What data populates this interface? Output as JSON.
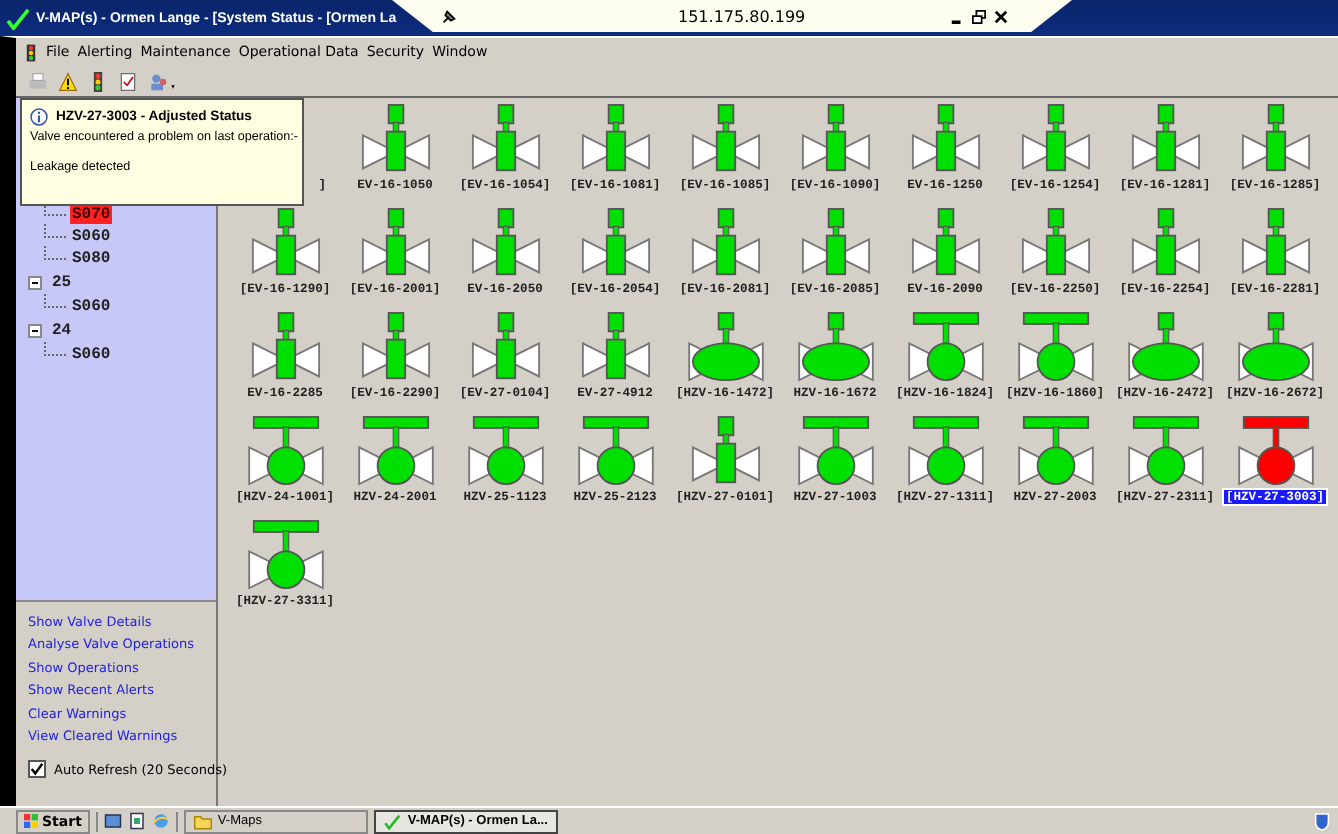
{
  "window": {
    "title": "V-MAP(s) - Ormen Lange - [System Status - [Ormen La"
  },
  "remote_bar": {
    "address": "151.175.80.199"
  },
  "menu": [
    "File",
    "Alerting",
    "Maintenance",
    "Operational Data",
    "Security",
    "Window"
  ],
  "tooltip": {
    "title": "HZV-27-3003 - Adjusted Status",
    "message": "Valve encountered a problem on last operation:-",
    "detail": "Leakage detected"
  },
  "tree": [
    {
      "children": [
        {
          "label": "S070",
          "alert": true
        },
        {
          "label": "S060",
          "alert": false
        },
        {
          "label": "S080",
          "alert": false
        }
      ]
    },
    {
      "label": "25",
      "expanded": true,
      "children": [
        {
          "label": "S060",
          "alert": false
        }
      ]
    },
    {
      "label": "24",
      "expanded": true,
      "children": [
        {
          "label": "S060",
          "alert": false
        }
      ]
    }
  ],
  "actions": [
    "Show Valve Details",
    "Analyse Valve Operations",
    "Show Operations",
    "Show Recent Alerts",
    "Clear Warnings",
    "View Cleared Warnings"
  ],
  "auto_refresh": {
    "label": "Auto Refresh (20 Seconds)",
    "checked": true
  },
  "valves": [
    {
      "label": "]",
      "kind": "hidden",
      "selected": false
    },
    {
      "label": "EV-16-1050",
      "kind": "gate",
      "color": "#00e000",
      "selected": false
    },
    {
      "label": "[EV-16-1054]",
      "kind": "gate",
      "color": "#00e000",
      "selected": false
    },
    {
      "label": "[EV-16-1081]",
      "kind": "gate",
      "color": "#00e000",
      "selected": false
    },
    {
      "label": "[EV-16-1085]",
      "kind": "gate",
      "color": "#00e000",
      "selected": false
    },
    {
      "label": "[EV-16-1090]",
      "kind": "gate",
      "color": "#00e000",
      "selected": false
    },
    {
      "label": "EV-16-1250",
      "kind": "gate",
      "color": "#00e000",
      "selected": false
    },
    {
      "label": "[EV-16-1254]",
      "kind": "gate",
      "color": "#00e000",
      "selected": false
    },
    {
      "label": "[EV-16-1281]",
      "kind": "gate",
      "color": "#00e000",
      "selected": false
    },
    {
      "label": "[EV-16-1285]",
      "kind": "gate",
      "color": "#00e000",
      "selected": false
    },
    {
      "label": "[EV-16-1290]",
      "kind": "gate",
      "color": "#00e000",
      "selected": false
    },
    {
      "label": "[EV-16-2001]",
      "kind": "gate",
      "color": "#00e000",
      "selected": false
    },
    {
      "label": "EV-16-2050",
      "kind": "gate",
      "color": "#00e000",
      "selected": false
    },
    {
      "label": "[EV-16-2054]",
      "kind": "gate",
      "color": "#00e000",
      "selected": false
    },
    {
      "label": "[EV-16-2081]",
      "kind": "gate",
      "color": "#00e000",
      "selected": false
    },
    {
      "label": "[EV-16-2085]",
      "kind": "gate",
      "color": "#00e000",
      "selected": false
    },
    {
      "label": "EV-16-2090",
      "kind": "gate",
      "color": "#00e000",
      "selected": false
    },
    {
      "label": "[EV-16-2250]",
      "kind": "gate",
      "color": "#00e000",
      "selected": false
    },
    {
      "label": "[EV-16-2254]",
      "kind": "gate",
      "color": "#00e000",
      "selected": false
    },
    {
      "label": "[EV-16-2281]",
      "kind": "gate",
      "color": "#00e000",
      "selected": false
    },
    {
      "label": "EV-16-2285",
      "kind": "gate",
      "color": "#00e000",
      "selected": false
    },
    {
      "label": "[EV-16-2290]",
      "kind": "gate",
      "color": "#00e000",
      "selected": false
    },
    {
      "label": "[EV-27-0104]",
      "kind": "gate",
      "color": "#00e000",
      "selected": false
    },
    {
      "label": "EV-27-4912",
      "kind": "gate",
      "color": "#00e000",
      "selected": false
    },
    {
      "label": "[HZV-16-1472]",
      "kind": "globe",
      "color": "#00e000",
      "selected": false
    },
    {
      "label": "HZV-16-1672",
      "kind": "globe",
      "color": "#00e000",
      "selected": false
    },
    {
      "label": "[HZV-16-1824]",
      "kind": "ball",
      "color": "#00e000",
      "selected": false
    },
    {
      "label": "[HZV-16-1860]",
      "kind": "ball",
      "color": "#00e000",
      "selected": false
    },
    {
      "label": "[HZV-16-2472]",
      "kind": "globe",
      "color": "#00e000",
      "selected": false
    },
    {
      "label": "[HZV-16-2672]",
      "kind": "globe",
      "color": "#00e000",
      "selected": false
    },
    {
      "label": "[HZV-24-1001]",
      "kind": "ball",
      "color": "#00e000",
      "selected": false
    },
    {
      "label": "HZV-24-2001",
      "kind": "ball",
      "color": "#00e000",
      "selected": false
    },
    {
      "label": "HZV-25-1123",
      "kind": "ball",
      "color": "#00e000",
      "selected": false
    },
    {
      "label": "HZV-25-2123",
      "kind": "ball",
      "color": "#00e000",
      "selected": false
    },
    {
      "label": "[HZV-27-0101]",
      "kind": "gate",
      "color": "#00e000",
      "selected": false
    },
    {
      "label": "HZV-27-1003",
      "kind": "ball",
      "color": "#00e000",
      "selected": false
    },
    {
      "label": "[HZV-27-1311]",
      "kind": "ball",
      "color": "#00e000",
      "selected": false
    },
    {
      "label": "HZV-27-2003",
      "kind": "ball",
      "color": "#00e000",
      "selected": false
    },
    {
      "label": "[HZV-27-2311]",
      "kind": "ball",
      "color": "#00e000",
      "selected": false
    },
    {
      "label": "[HZV-27-3003]",
      "kind": "ball",
      "color": "#ff0000",
      "selected": true
    },
    {
      "label": "[HZV-27-3311]",
      "kind": "ball",
      "color": "#00e000",
      "selected": false
    }
  ],
  "taskbar": {
    "start": "Start",
    "buttons": [
      {
        "label": "V-Maps",
        "selected": false
      },
      {
        "label": "V-MAP(s) - Ormen La...",
        "selected": true
      }
    ]
  }
}
